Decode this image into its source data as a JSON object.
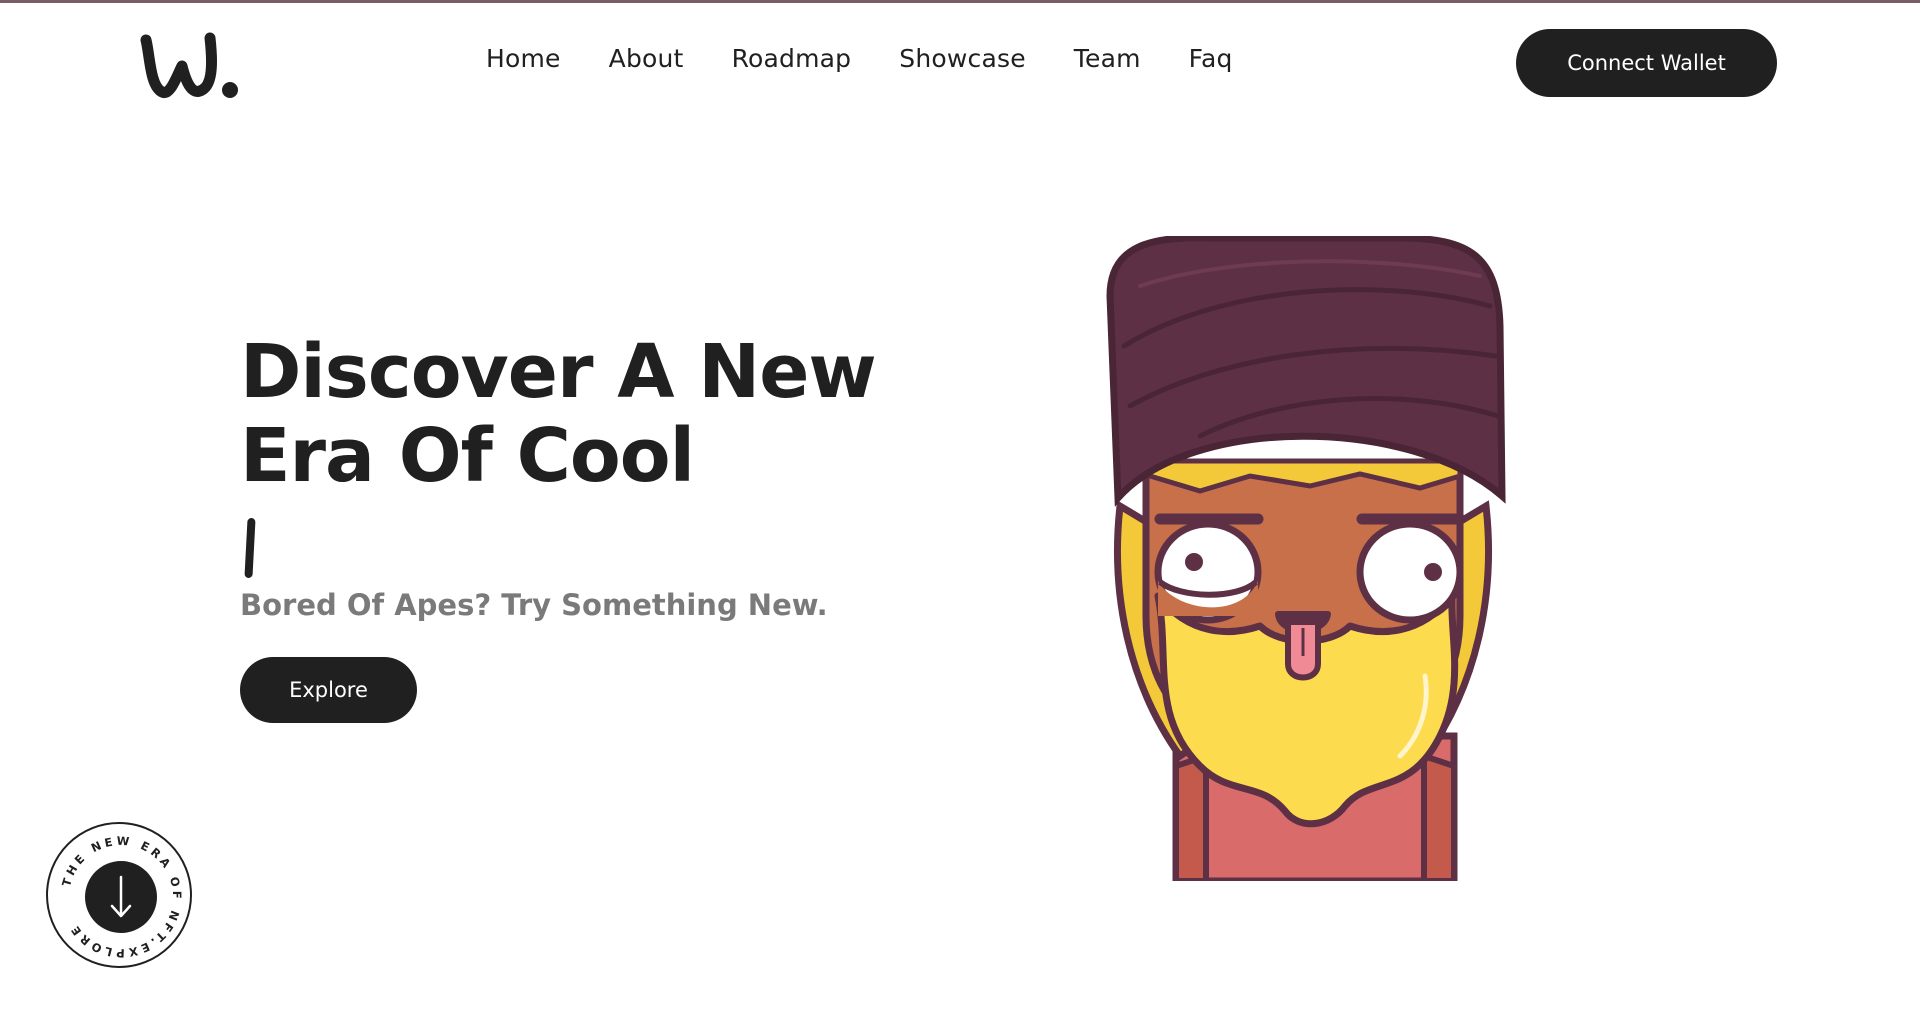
{
  "header": {
    "logo_text": "W.",
    "nav": [
      "Home",
      "About",
      "Roadmap",
      "Showcase",
      "Team",
      "Faq"
    ],
    "connect_label": "Connect Wallet"
  },
  "hero": {
    "title_line1": "Discover A New",
    "title_line2": "Era Of Cool",
    "subtitle": "Bored Of Apes? Try Something New.",
    "explore_label": "Explore"
  },
  "badge": {
    "circle_text": "THE NEW ERA OF NFT.EXPLORE",
    "icon": "arrow-down-icon"
  },
  "colors": {
    "dark": "#202020",
    "turban": "#5e3045",
    "skin": "#c8704a",
    "beard": "#fddb4e",
    "shirt": "#d96b6b"
  }
}
